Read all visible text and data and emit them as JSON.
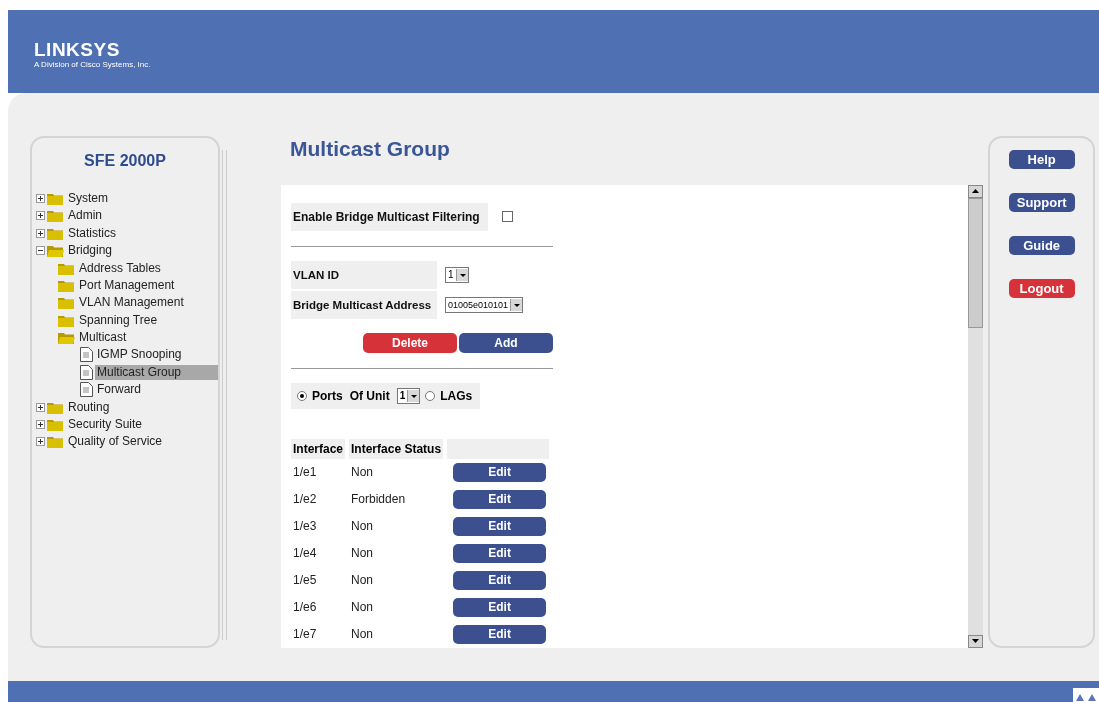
{
  "header": {
    "logo": "LINKSYS",
    "tagline": "A Division of Cisco Systems, Inc."
  },
  "sidebar": {
    "title": "SFE 2000P",
    "tree": [
      {
        "label": "System",
        "kind": "folder",
        "expanded": false,
        "selected": false
      },
      {
        "label": "Admin",
        "kind": "folder",
        "expanded": false,
        "selected": false
      },
      {
        "label": "Statistics",
        "kind": "folder",
        "expanded": false,
        "selected": false
      },
      {
        "label": "Bridging",
        "kind": "folder",
        "expanded": true,
        "selected": false,
        "children": [
          {
            "label": "Address Tables",
            "kind": "folder",
            "expanded": false,
            "selected": false
          },
          {
            "label": "Port Management",
            "kind": "folder",
            "expanded": false,
            "selected": false
          },
          {
            "label": "VLAN Management",
            "kind": "folder",
            "expanded": false,
            "selected": false
          },
          {
            "label": "Spanning Tree",
            "kind": "folder",
            "expanded": false,
            "selected": false
          },
          {
            "label": "Multicast",
            "kind": "folder",
            "expanded": true,
            "selected": false,
            "children": [
              {
                "label": "IGMP Snooping",
                "kind": "page",
                "selected": false
              },
              {
                "label": "Multicast Group",
                "kind": "page",
                "selected": true
              },
              {
                "label": "Forward",
                "kind": "page",
                "selected": false
              }
            ]
          }
        ]
      },
      {
        "label": "Routing",
        "kind": "folder",
        "expanded": false,
        "selected": false
      },
      {
        "label": "Security Suite",
        "kind": "folder",
        "expanded": false,
        "selected": false
      },
      {
        "label": "Quality of Service",
        "kind": "folder",
        "expanded": false,
        "selected": false
      }
    ]
  },
  "page_title": "Multicast Group",
  "filtering": {
    "label": "Enable Bridge Multicast Filtering",
    "checked": false
  },
  "vlan_id": {
    "label": "VLAN ID",
    "value": "1"
  },
  "multicast_address": {
    "label": "Bridge Multicast Address",
    "value": "01005e010101"
  },
  "actions": [
    {
      "label": "Delete",
      "kind": "danger"
    },
    {
      "label": "Add",
      "kind": "primary"
    }
  ],
  "filter": {
    "ports": {
      "label": "Ports",
      "selected": true
    },
    "unit_label": "Of Unit",
    "unit": "1",
    "lags": {
      "label": "LAGs",
      "selected": false
    }
  },
  "table": {
    "columns": [
      "Interface",
      "Interface Status"
    ],
    "rows": [
      {
        "interface": "1/e1",
        "status": "Non",
        "action": "Edit"
      },
      {
        "interface": "1/e2",
        "status": "Forbidden",
        "action": "Edit"
      },
      {
        "interface": "1/e3",
        "status": "Non",
        "action": "Edit"
      },
      {
        "interface": "1/e4",
        "status": "Non",
        "action": "Edit"
      },
      {
        "interface": "1/e5",
        "status": "Non",
        "action": "Edit"
      },
      {
        "interface": "1/e6",
        "status": "Non",
        "action": "Edit"
      },
      {
        "interface": "1/e7",
        "status": "Non",
        "action": "Edit"
      }
    ]
  },
  "right_buttons": [
    {
      "label": "Help",
      "kind": "primary"
    },
    {
      "label": "Support",
      "kind": "primary"
    },
    {
      "label": "Guide",
      "kind": "primary"
    },
    {
      "label": "Logout",
      "kind": "danger"
    }
  ]
}
